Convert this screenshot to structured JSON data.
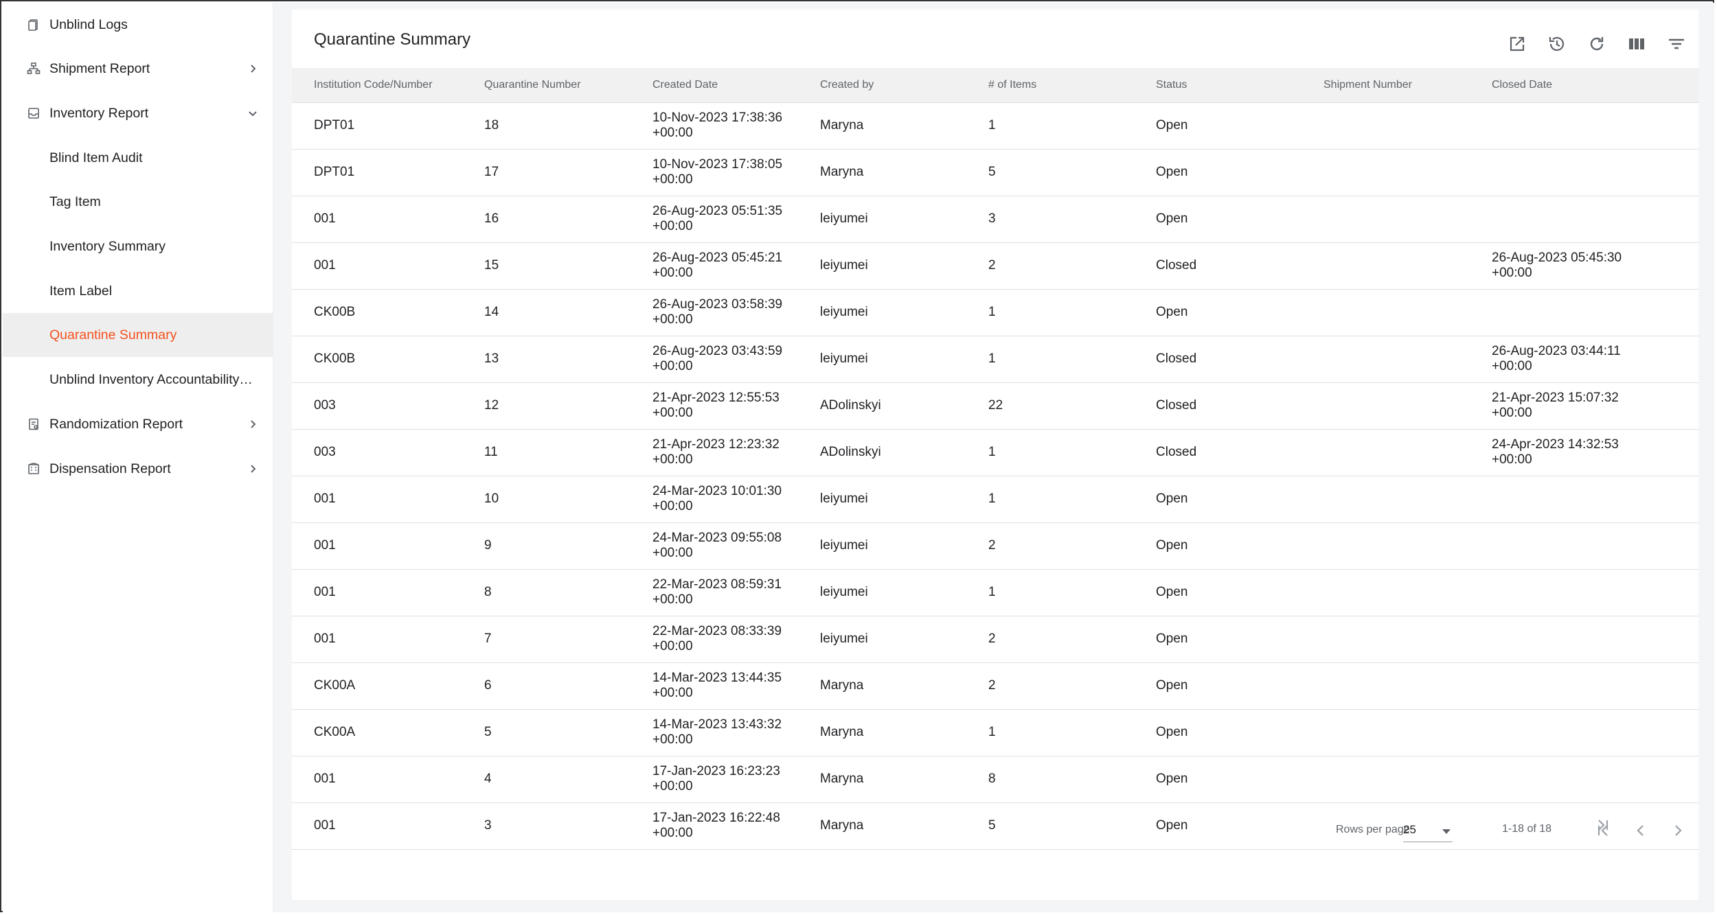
{
  "sidebar": {
    "items": [
      {
        "label": "Unblind Logs",
        "icon": "clipboard-icon",
        "chevron": "none",
        "active": false
      },
      {
        "label": "Shipment Report",
        "icon": "org-chart-icon",
        "chevron": "right",
        "active": false
      },
      {
        "label": "Inventory Report",
        "icon": "inbox-icon",
        "chevron": "down",
        "active": false
      },
      {
        "label": "Blind Item Audit",
        "icon": "",
        "chevron": "none",
        "active": false
      },
      {
        "label": "Tag Item",
        "icon": "",
        "chevron": "none",
        "active": false
      },
      {
        "label": "Inventory Summary",
        "icon": "",
        "chevron": "none",
        "active": false
      },
      {
        "label": "Item Label",
        "icon": "",
        "chevron": "none",
        "active": false
      },
      {
        "label": "Quarantine Summary",
        "icon": "",
        "chevron": "none",
        "active": true
      },
      {
        "label": "Unblind Inventory Accountability …",
        "icon": "",
        "chevron": "none",
        "active": false
      },
      {
        "label": "Randomization Report",
        "icon": "report-icon",
        "chevron": "right",
        "active": false
      },
      {
        "label": "Dispensation Report",
        "icon": "building-icon",
        "chevron": "right",
        "active": false
      }
    ]
  },
  "main": {
    "title": "Quarantine Summary",
    "toolbar": [
      "open-external-icon",
      "history-icon",
      "refresh-icon",
      "columns-icon",
      "filter-icon"
    ],
    "columns": [
      "Institution Code/Number",
      "Quarantine Number",
      "Created Date",
      "Created by",
      "# of Items",
      "Status",
      "Shipment Number",
      "Closed Date"
    ],
    "rows": [
      [
        "DPT01",
        "18",
        "10-Nov-2023 17:38:36 +00:00",
        "Maryna",
        "1",
        "Open",
        "",
        ""
      ],
      [
        "DPT01",
        "17",
        "10-Nov-2023 17:38:05 +00:00",
        "Maryna",
        "5",
        "Open",
        "",
        ""
      ],
      [
        "001",
        "16",
        "26-Aug-2023 05:51:35 +00:00",
        "leiyumei",
        "3",
        "Open",
        "",
        ""
      ],
      [
        "001",
        "15",
        "26-Aug-2023 05:45:21 +00:00",
        "leiyumei",
        "2",
        "Closed",
        "",
        "26-Aug-2023 05:45:30 +00:00"
      ],
      [
        "CK00B",
        "14",
        "26-Aug-2023 03:58:39 +00:00",
        "leiyumei",
        "1",
        "Open",
        "",
        ""
      ],
      [
        "CK00B",
        "13",
        "26-Aug-2023 03:43:59 +00:00",
        "leiyumei",
        "1",
        "Closed",
        "",
        "26-Aug-2023 03:44:11 +00:00"
      ],
      [
        "003",
        "12",
        "21-Apr-2023 12:55:53 +00:00",
        "ADolinskyi",
        "22",
        "Closed",
        "",
        "21-Apr-2023 15:07:32 +00:00"
      ],
      [
        "003",
        "11",
        "21-Apr-2023 12:23:32 +00:00",
        "ADolinskyi",
        "1",
        "Closed",
        "",
        "24-Apr-2023 14:32:53 +00:00"
      ],
      [
        "001",
        "10",
        "24-Mar-2023 10:01:30 +00:00",
        "leiyumei",
        "1",
        "Open",
        "",
        ""
      ],
      [
        "001",
        "9",
        "24-Mar-2023 09:55:08 +00:00",
        "leiyumei",
        "2",
        "Open",
        "",
        ""
      ],
      [
        "001",
        "8",
        "22-Mar-2023 08:59:31 +00:00",
        "leiyumei",
        "1",
        "Open",
        "",
        ""
      ],
      [
        "001",
        "7",
        "22-Mar-2023 08:33:39 +00:00",
        "leiyumei",
        "2",
        "Open",
        "",
        ""
      ],
      [
        "CK00A",
        "6",
        "14-Mar-2023 13:44:35 +00:00",
        "Maryna",
        "2",
        "Open",
        "",
        ""
      ],
      [
        "CK00A",
        "5",
        "14-Mar-2023 13:43:32 +00:00",
        "Maryna",
        "1",
        "Open",
        "",
        ""
      ],
      [
        "001",
        "4",
        "17-Jan-2023 16:23:23 +00:00",
        "Maryna",
        "8",
        "Open",
        "",
        ""
      ],
      [
        "001",
        "3",
        "17-Jan-2023 16:22:48 +00:00",
        "Maryna",
        "5",
        "Open",
        "",
        ""
      ]
    ],
    "pagination": {
      "rows_per_page_label": "Rows per page",
      "rows_per_page_value": "25",
      "range": "1-18 of 18"
    }
  },
  "colors": {
    "accent": "#f4511e",
    "active_bg": "#eeeeee",
    "header_bg": "#f1f1f1",
    "icon": "#5f6368"
  }
}
